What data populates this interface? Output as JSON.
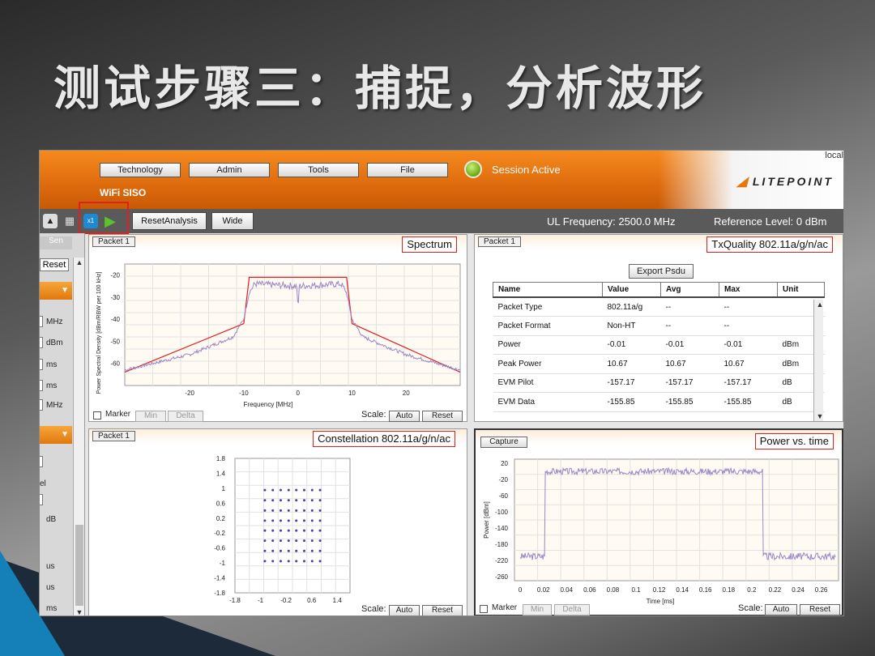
{
  "slide": {
    "title": "测试步骤三：捕捉，分析波形"
  },
  "header": {
    "menu": [
      "Technology",
      "Admin",
      "Tools",
      "File"
    ],
    "session_label": "Session Active",
    "mode_label": "WiFi SISO",
    "local_label": "local",
    "logo_text": "LITEPOINT",
    "brand_color": "#e8760f"
  },
  "toolbar": {
    "icons": [
      "home-icon",
      "calculator-icon",
      "single-capture-icon",
      "play-icon"
    ],
    "single_capture_text": "x1",
    "reset_analysis_label": "ResetAnalysis",
    "wide_label": "Wide",
    "ul_frequency": "UL Frequency: 2500.0 MHz",
    "reference_level": "Reference Level: 0 dBm"
  },
  "left_panel": {
    "tab": "Sen",
    "reset_label": "Reset",
    "units_top": [
      "MHz",
      "dBm",
      "ms",
      "ms",
      "MHz"
    ],
    "units_bottom": [
      "el",
      "dB",
      "us",
      "us",
      "ms"
    ]
  },
  "spectrum": {
    "tab": "Packet 1",
    "title": "Spectrum",
    "marker_label": "Marker",
    "min_label": "Min",
    "delta_label": "Delta",
    "scale_label": "Scale:",
    "auto_label": "Auto",
    "reset_label": "Reset"
  },
  "txquality": {
    "tab": "Packet 1",
    "title": "TxQuality 802.11a/g/n/ac",
    "export_label": "Export Psdu",
    "columns": [
      "Name",
      "Value",
      "Avg",
      "Max",
      "Unit"
    ],
    "rows": [
      [
        "Packet Type",
        "802.11a/g",
        "--",
        "--",
        ""
      ],
      [
        "Packet Format",
        "Non-HT",
        "--",
        "--",
        ""
      ],
      [
        "Power",
        "-0.01",
        "-0.01",
        "-0.01",
        "dBm"
      ],
      [
        "Peak Power",
        "10.67",
        "10.67",
        "10.67",
        "dBm"
      ],
      [
        "EVM Pilot",
        "-157.17",
        "-157.17",
        "-157.17",
        "dB"
      ],
      [
        "EVM Data",
        "-155.85",
        "-155.85",
        "-155.85",
        "dB"
      ]
    ]
  },
  "constellation": {
    "tab": "Packet 1",
    "title": "Constellation 802.11a/g/n/ac",
    "scale_label": "Scale:",
    "auto_label": "Auto",
    "reset_label": "Reset"
  },
  "power_time": {
    "capture_label": "Capture",
    "title": "Power vs. time",
    "marker_label": "Marker",
    "min_label": "Min",
    "delta_label": "Delta",
    "scale_label": "Scale:",
    "auto_label": "Auto",
    "reset_label": "Reset"
  },
  "chart_data": [
    {
      "type": "line",
      "name": "spectrum",
      "xlabel": "Frequency [MHz]",
      "ylabel": "Power Spectral Density [dBm/RBW per 100 kHz]",
      "xticks": [
        "-20",
        "-10",
        "0",
        "10",
        "20"
      ],
      "yticks": [
        "-20",
        "-30",
        "-40",
        "-50",
        "-60"
      ],
      "xlim": [
        -32,
        30
      ],
      "ylim": [
        -70,
        -15
      ],
      "series": [
        {
          "color": "#e02020",
          "x": [
            -32,
            -10,
            -9,
            9,
            10,
            30
          ],
          "y": [
            -64,
            -42,
            -21,
            -21,
            -42,
            -64
          ]
        },
        {
          "color": "#9b86c8",
          "x": [
            -32,
            -20,
            -12,
            -10,
            -9,
            -8,
            0,
            8,
            9,
            10,
            12,
            20,
            30
          ],
          "y": [
            -63,
            -56,
            -48,
            -40,
            -28,
            -24,
            -25,
            -24,
            -28,
            -40,
            -48,
            -56,
            -63
          ]
        }
      ]
    },
    {
      "type": "scatter",
      "name": "constellation",
      "yticks": [
        "1.8",
        "1.4",
        "1",
        "0.6",
        "0.2",
        "-0.2",
        "-0.6",
        "-1",
        "-1.4",
        "-1.8"
      ],
      "xticks": [
        "-1.8",
        "-1",
        "-0.2",
        "0.6",
        "1.4"
      ],
      "xlim": [
        -1.8,
        1.8
      ],
      "ylim": [
        -1.8,
        1.8
      ],
      "points_levels": [
        -1.08,
        -0.77,
        -0.46,
        -0.15,
        0.15,
        0.46,
        0.77,
        1.08
      ]
    },
    {
      "type": "line",
      "name": "power_vs_time",
      "xlabel": "Time [ms]",
      "ylabel": "Power [dBm]",
      "xticks": [
        "0",
        "0.02",
        "0.04",
        "0.06",
        "0.08",
        "0.1",
        "0.12",
        "0.14",
        "0.16",
        "0.18",
        "0.2",
        "0.22",
        "0.24",
        "0.26"
      ],
      "yticks": [
        "20",
        "-20",
        "-60",
        "-100",
        "-140",
        "-180",
        "-220",
        "-260"
      ],
      "xlim": [
        -0.005,
        0.275
      ],
      "ylim": [
        -270,
        30
      ],
      "series": [
        {
          "color": "#9b86c8",
          "x": [
            0,
            0.021,
            0.022,
            0.209,
            0.21,
            0.275
          ],
          "y": [
            -210,
            -210,
            0,
            0,
            -210,
            -210
          ]
        }
      ]
    }
  ]
}
